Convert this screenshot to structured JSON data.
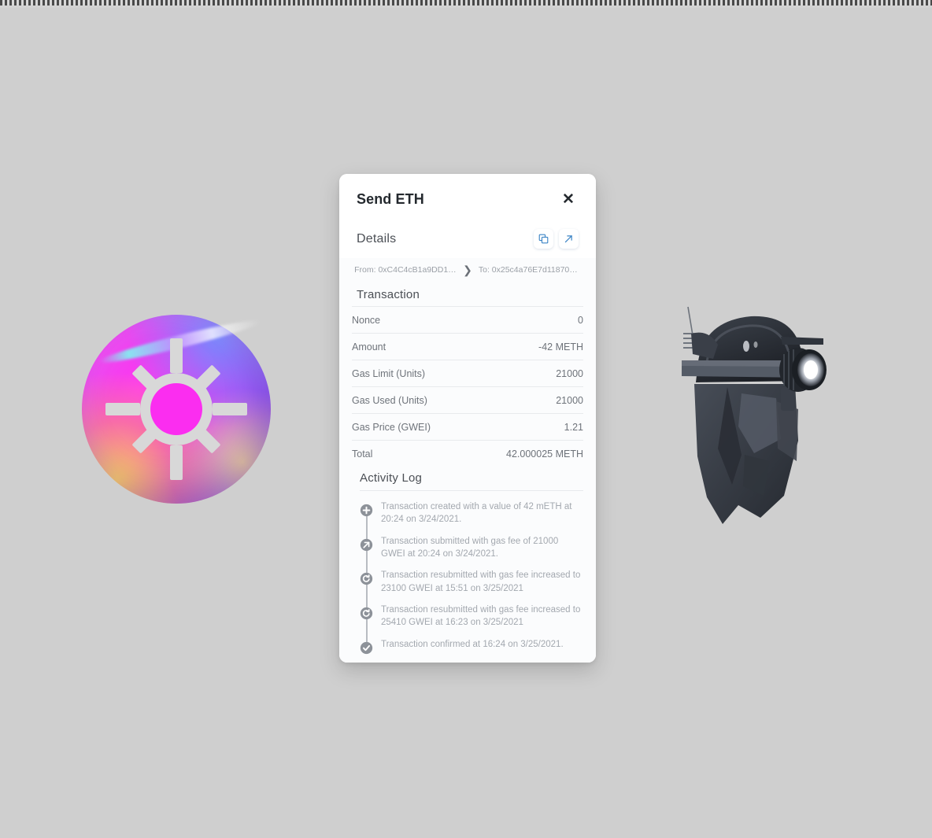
{
  "window": {
    "background_color": "#cfcfcf",
    "top_strip": "hatched-strip"
  },
  "artwork": {
    "left": {
      "name": "gradient-orb-sun-logo",
      "colors": [
        "#ff3df0",
        "#9b4bf5",
        "#6f5bf7",
        "#ffd75a",
        "#ff966e"
      ]
    },
    "right": {
      "name": "dark-helmet-with-headlamp",
      "colors": [
        "#2b2f36",
        "#3e444d",
        "#ffffff"
      ]
    }
  },
  "modal": {
    "title": "Send ETH",
    "close_label": "✕",
    "details": {
      "heading": "Details",
      "copy_icon": "copy-icon",
      "open_icon": "external-link-icon",
      "from": "From: 0xC4C4cB1a9DD13...",
      "to": "To: 0x25c4a76E7d118705e...",
      "chevron": "›"
    },
    "transaction": {
      "heading": "Transaction",
      "rows": [
        {
          "label": "Nonce",
          "value": "0"
        },
        {
          "label": "Amount",
          "value": "-42 METH"
        },
        {
          "label": "Gas Limit (Units)",
          "value": "21000"
        },
        {
          "label": "Gas Used (Units)",
          "value": "21000"
        },
        {
          "label": "Gas Price (GWEI)",
          "value": "1.21"
        },
        {
          "label": "Total",
          "value": "42.000025 METH"
        }
      ]
    },
    "activity_log": {
      "heading": "Activity Log",
      "entries": [
        {
          "icon": "plus-circle-icon",
          "text": "Transaction created with a value of 42 mETH at 20:24 on 3/24/2021."
        },
        {
          "icon": "arrow-up-right-circle-icon",
          "text": "Transaction submitted with gas fee of 21000 GWEI at 20:24 on 3/24/2021."
        },
        {
          "icon": "retry-circle-icon",
          "text": "Transaction resubmitted with gas fee increased to 23100 GWEI at 15:51 on 3/25/2021"
        },
        {
          "icon": "retry-circle-icon",
          "text": "Transaction resubmitted with gas fee increased to 25410 GWEI at 16:23 on 3/25/2021"
        },
        {
          "icon": "check-circle-icon",
          "text": "Transaction confirmed at 16:24 on 3/25/2021."
        }
      ]
    }
  },
  "colors": {
    "accent_blue": "#3d85c6",
    "marker_gray": "#8d9299",
    "text_muted": "#a3a8af"
  }
}
